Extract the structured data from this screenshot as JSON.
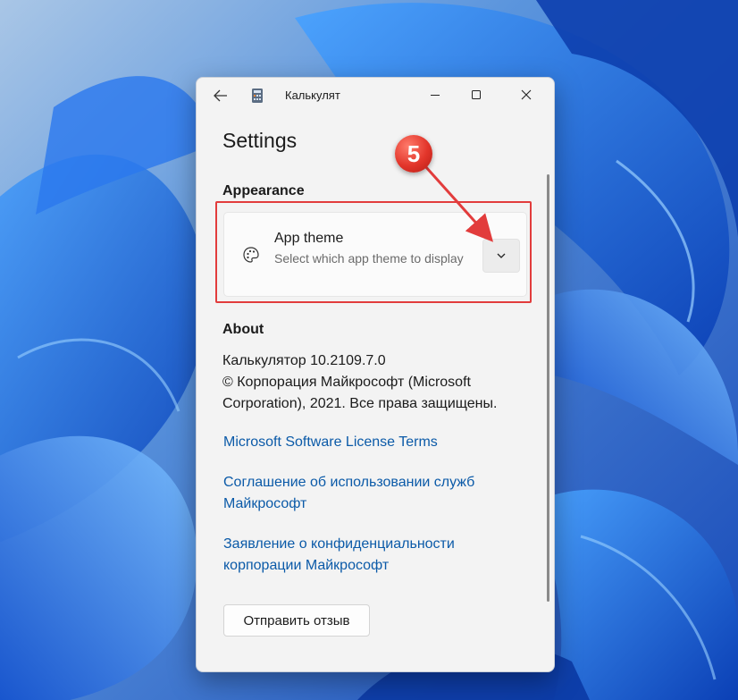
{
  "window": {
    "title": "Калькулят",
    "controls": {
      "minimize_icon": "minimize-icon",
      "maximize_icon": "maximize-icon",
      "close_icon": "close-icon",
      "back_icon": "back-arrow-icon"
    }
  },
  "settings": {
    "title": "Settings",
    "appearance": {
      "section_title": "Appearance",
      "app_theme": {
        "label": "App theme",
        "description": "Select which app theme to display",
        "icon": "palette-icon",
        "dropdown_icon": "chevron-down-icon"
      }
    },
    "about": {
      "section_title": "About",
      "version_line": "Калькулятор 10.2109.7.0",
      "copyright": "© Корпорация Майкрософт (Microsoft Corporation), 2021. Все права защищены.",
      "links": {
        "license": "Microsoft Software License Terms",
        "services": "Соглашение об использовании служб Майкрософт",
        "privacy": "Заявление о конфиденциальности корпорации Майкрософт"
      }
    },
    "feedback_button": "Отправить отзыв"
  },
  "annotation": {
    "step_number": "5",
    "color": "#e23c3c"
  },
  "colors": {
    "link": "#0b5aa8",
    "window_bg": "#f3f3f3",
    "wallpaper": "#1e5fd0"
  }
}
